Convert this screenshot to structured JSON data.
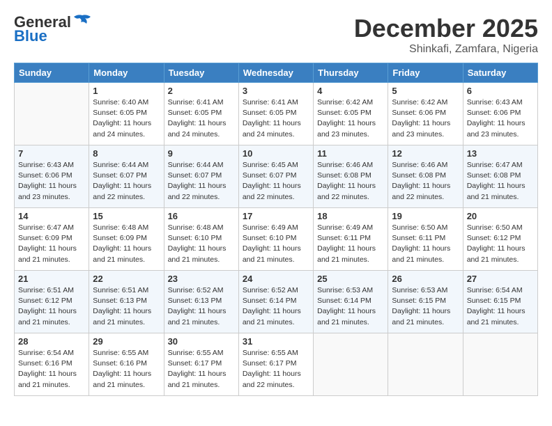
{
  "header": {
    "logo_general": "General",
    "logo_blue": "Blue",
    "month": "December 2025",
    "location": "Shinkafi, Zamfara, Nigeria"
  },
  "days_of_week": [
    "Sunday",
    "Monday",
    "Tuesday",
    "Wednesday",
    "Thursday",
    "Friday",
    "Saturday"
  ],
  "weeks": [
    [
      {
        "day": "",
        "sunrise": "",
        "sunset": "",
        "daylight": ""
      },
      {
        "day": "1",
        "sunrise": "6:40 AM",
        "sunset": "6:05 PM",
        "daylight": "11 hours and 24 minutes."
      },
      {
        "day": "2",
        "sunrise": "6:41 AM",
        "sunset": "6:05 PM",
        "daylight": "11 hours and 24 minutes."
      },
      {
        "day": "3",
        "sunrise": "6:41 AM",
        "sunset": "6:05 PM",
        "daylight": "11 hours and 24 minutes."
      },
      {
        "day": "4",
        "sunrise": "6:42 AM",
        "sunset": "6:05 PM",
        "daylight": "11 hours and 23 minutes."
      },
      {
        "day": "5",
        "sunrise": "6:42 AM",
        "sunset": "6:06 PM",
        "daylight": "11 hours and 23 minutes."
      },
      {
        "day": "6",
        "sunrise": "6:43 AM",
        "sunset": "6:06 PM",
        "daylight": "11 hours and 23 minutes."
      }
    ],
    [
      {
        "day": "7",
        "sunrise": "6:43 AM",
        "sunset": "6:06 PM",
        "daylight": "11 hours and 23 minutes."
      },
      {
        "day": "8",
        "sunrise": "6:44 AM",
        "sunset": "6:07 PM",
        "daylight": "11 hours and 22 minutes."
      },
      {
        "day": "9",
        "sunrise": "6:44 AM",
        "sunset": "6:07 PM",
        "daylight": "11 hours and 22 minutes."
      },
      {
        "day": "10",
        "sunrise": "6:45 AM",
        "sunset": "6:07 PM",
        "daylight": "11 hours and 22 minutes."
      },
      {
        "day": "11",
        "sunrise": "6:46 AM",
        "sunset": "6:08 PM",
        "daylight": "11 hours and 22 minutes."
      },
      {
        "day": "12",
        "sunrise": "6:46 AM",
        "sunset": "6:08 PM",
        "daylight": "11 hours and 22 minutes."
      },
      {
        "day": "13",
        "sunrise": "6:47 AM",
        "sunset": "6:08 PM",
        "daylight": "11 hours and 21 minutes."
      }
    ],
    [
      {
        "day": "14",
        "sunrise": "6:47 AM",
        "sunset": "6:09 PM",
        "daylight": "11 hours and 21 minutes."
      },
      {
        "day": "15",
        "sunrise": "6:48 AM",
        "sunset": "6:09 PM",
        "daylight": "11 hours and 21 minutes."
      },
      {
        "day": "16",
        "sunrise": "6:48 AM",
        "sunset": "6:10 PM",
        "daylight": "11 hours and 21 minutes."
      },
      {
        "day": "17",
        "sunrise": "6:49 AM",
        "sunset": "6:10 PM",
        "daylight": "11 hours and 21 minutes."
      },
      {
        "day": "18",
        "sunrise": "6:49 AM",
        "sunset": "6:11 PM",
        "daylight": "11 hours and 21 minutes."
      },
      {
        "day": "19",
        "sunrise": "6:50 AM",
        "sunset": "6:11 PM",
        "daylight": "11 hours and 21 minutes."
      },
      {
        "day": "20",
        "sunrise": "6:50 AM",
        "sunset": "6:12 PM",
        "daylight": "11 hours and 21 minutes."
      }
    ],
    [
      {
        "day": "21",
        "sunrise": "6:51 AM",
        "sunset": "6:12 PM",
        "daylight": "11 hours and 21 minutes."
      },
      {
        "day": "22",
        "sunrise": "6:51 AM",
        "sunset": "6:13 PM",
        "daylight": "11 hours and 21 minutes."
      },
      {
        "day": "23",
        "sunrise": "6:52 AM",
        "sunset": "6:13 PM",
        "daylight": "11 hours and 21 minutes."
      },
      {
        "day": "24",
        "sunrise": "6:52 AM",
        "sunset": "6:14 PM",
        "daylight": "11 hours and 21 minutes."
      },
      {
        "day": "25",
        "sunrise": "6:53 AM",
        "sunset": "6:14 PM",
        "daylight": "11 hours and 21 minutes."
      },
      {
        "day": "26",
        "sunrise": "6:53 AM",
        "sunset": "6:15 PM",
        "daylight": "11 hours and 21 minutes."
      },
      {
        "day": "27",
        "sunrise": "6:54 AM",
        "sunset": "6:15 PM",
        "daylight": "11 hours and 21 minutes."
      }
    ],
    [
      {
        "day": "28",
        "sunrise": "6:54 AM",
        "sunset": "6:16 PM",
        "daylight": "11 hours and 21 minutes."
      },
      {
        "day": "29",
        "sunrise": "6:55 AM",
        "sunset": "6:16 PM",
        "daylight": "11 hours and 21 minutes."
      },
      {
        "day": "30",
        "sunrise": "6:55 AM",
        "sunset": "6:17 PM",
        "daylight": "11 hours and 21 minutes."
      },
      {
        "day": "31",
        "sunrise": "6:55 AM",
        "sunset": "6:17 PM",
        "daylight": "11 hours and 22 minutes."
      },
      {
        "day": "",
        "sunrise": "",
        "sunset": "",
        "daylight": ""
      },
      {
        "day": "",
        "sunrise": "",
        "sunset": "",
        "daylight": ""
      },
      {
        "day": "",
        "sunrise": "",
        "sunset": "",
        "daylight": ""
      }
    ]
  ],
  "labels": {
    "sunrise": "Sunrise:",
    "sunset": "Sunset:",
    "daylight": "Daylight:"
  }
}
